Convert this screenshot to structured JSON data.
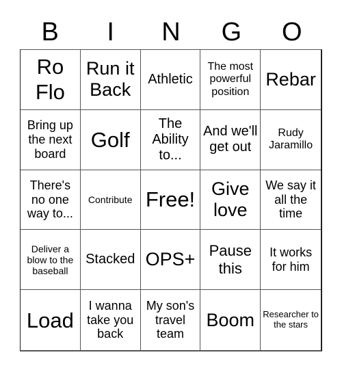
{
  "header": {
    "letters": [
      "B",
      "I",
      "N",
      "G",
      "O"
    ]
  },
  "board": {
    "rows": [
      [
        "Ro Flo",
        "Run it Back",
        "Athletic",
        "The most powerful position",
        "Rebar"
      ],
      [
        "Bring up the next board",
        "Golf",
        "The Ability to...",
        "And we'll get out",
        "Rudy Jaramillo"
      ],
      [
        "There's no one way to...",
        "Contribute",
        "Free!",
        "Give love",
        "We say it all the time"
      ],
      [
        "Deliver a blow to the baseball",
        "Stacked",
        "OPS+",
        "Pause this",
        "It works for him"
      ],
      [
        "Load",
        "I wanna take you back",
        "My son's travel team",
        "Boom",
        "Researcher to the stars"
      ]
    ]
  }
}
